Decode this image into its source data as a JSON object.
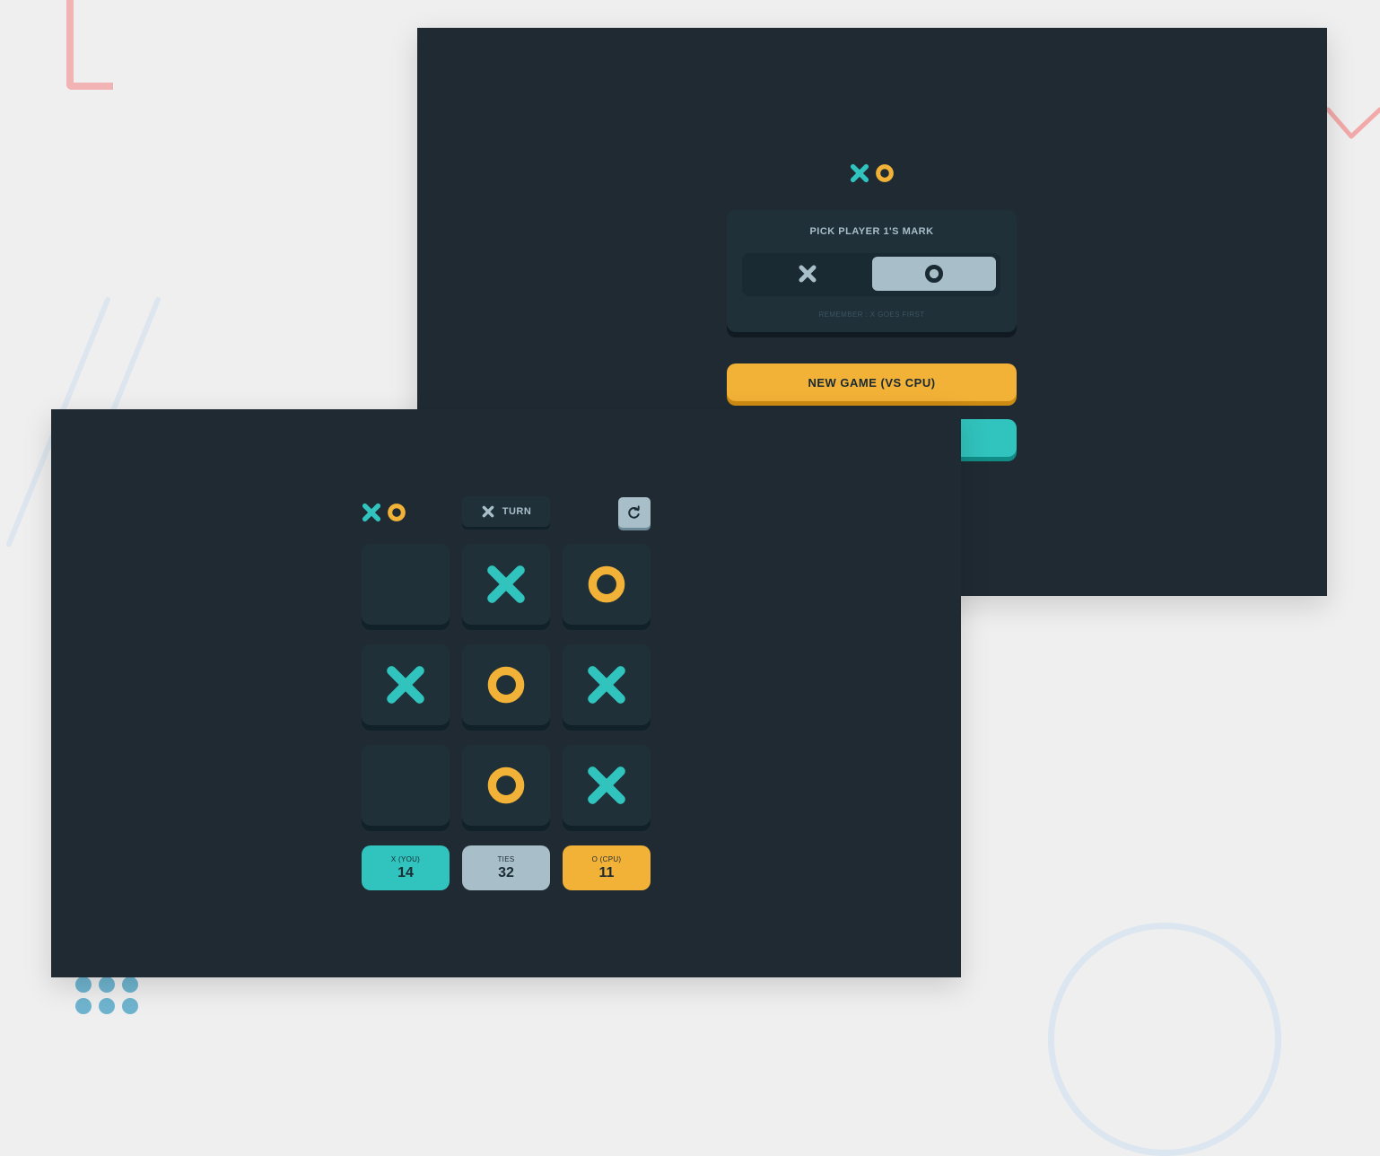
{
  "menu": {
    "pick_title": "PICK PLAYER 1'S MARK",
    "hint": "REMEMBER : X GOES FIRST",
    "selected_mark": "O",
    "new_game_cpu": "NEW GAME (VS CPU)"
  },
  "game": {
    "turn_label": "TURN",
    "current_turn": "X",
    "board": [
      "",
      "X",
      "O",
      "X",
      "O",
      "X",
      "",
      "O",
      "X"
    ],
    "scores": [
      {
        "label": "X (YOU)",
        "value": "14"
      },
      {
        "label": "TIES",
        "value": "32"
      },
      {
        "label": "O (CPU)",
        "value": "11"
      }
    ]
  },
  "colors": {
    "x_mark": "#31c3bd",
    "o_mark": "#f2b137",
    "silver": "#a8bfc9",
    "navy": "#1f2a33"
  },
  "icons": {
    "restart": "restart-icon",
    "x": "x-mark-icon",
    "o": "o-mark-icon"
  }
}
